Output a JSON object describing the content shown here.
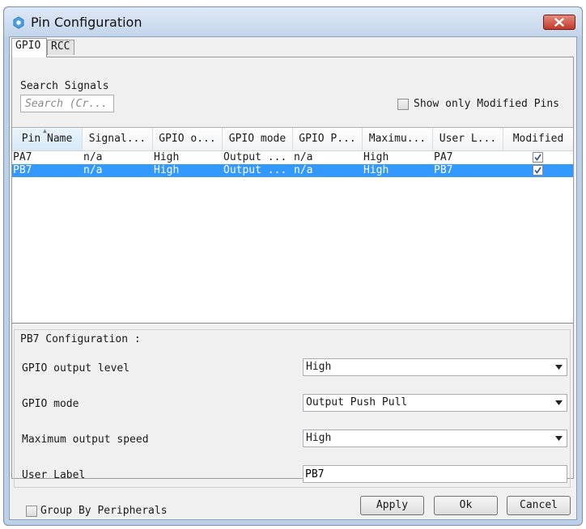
{
  "window": {
    "title": "Pin Configuration",
    "icon": "gear-icon",
    "accent": "#3399ff"
  },
  "tabs": [
    {
      "label": "GPIO",
      "active": true
    },
    {
      "label": "RCC",
      "active": false
    }
  ],
  "search": {
    "label": "Search Signals",
    "placeholder": "Search (Cr..."
  },
  "filter": {
    "label": "Show only Modified Pins",
    "checked": false
  },
  "table": {
    "columns": [
      "Pin Name",
      "Signal...",
      "GPIO o...",
      "GPIO mode",
      "GPIO P...",
      "Maximu...",
      "User L...",
      "Modified"
    ],
    "rows": [
      {
        "pin": "PA7",
        "signal": "n/a",
        "output": "High",
        "mode": "Output ...",
        "pull": "n/a",
        "speed": "High",
        "label": "PA7",
        "modified": true
      },
      {
        "pin": "PB7",
        "signal": "n/a",
        "output": "High",
        "mode": "Output ...",
        "pull": "n/a",
        "speed": "High",
        "label": "PB7",
        "modified": true
      }
    ],
    "selected_row": 1
  },
  "config": {
    "title": "PB7 Configuration :",
    "fields": [
      {
        "label": "GPIO output level",
        "value": "High"
      },
      {
        "label": "GPIO mode",
        "value": "Output Push Pull"
      },
      {
        "label": "Maximum output speed",
        "value": "High"
      },
      {
        "label": "User Label",
        "value": "PB7"
      }
    ]
  },
  "footer": {
    "group_label": "Group By Peripherals",
    "group_checked": false,
    "apply": "Apply",
    "ok": "Ok",
    "cancel": "Cancel"
  }
}
